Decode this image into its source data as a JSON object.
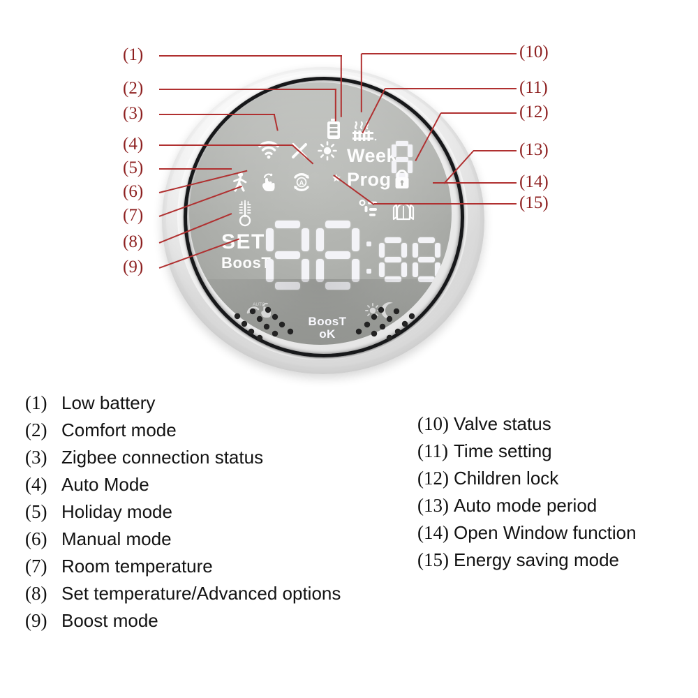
{
  "document": {
    "type": "product-diagram",
    "subject": "Smart radiator thermostat LCD display legend",
    "background_color": "#ffffff",
    "callout_color": "#b03030"
  },
  "device": {
    "name": "round-smart-thermostat",
    "body_color": "#e9e9e9",
    "ring_color": "#17181a",
    "screen_color": "#b0b2ae",
    "segment_color": "#f3f3f7",
    "screen": {
      "labels": {
        "week": "Week",
        "prog": "Prog",
        "set": "SET",
        "boost": "BoosT"
      },
      "temperature_value": "88",
      "time_value": "88",
      "time_separator": ":",
      "icons": [
        "battery-low-icon",
        "radiator-heat-icon",
        "zigbee-signal-icon",
        "cross-icon",
        "sun-comfort-icon",
        "walking-person-holiday-icon",
        "hand-manual-icon",
        "auto-a-circle-icon",
        "moon-star-eco-icon",
        "thermometer-room-temp-icon",
        "padlock-children-lock-icon",
        "open-window-icon",
        "auto-period-segments-icon"
      ]
    },
    "buttons": {
      "left_icon": "auto-manual-toggle-icon",
      "right_icon": "sun-moon-toggle-icon",
      "center_primary": "BoosT",
      "center_secondary": "oK"
    }
  },
  "callouts": {
    "left": [
      {
        "num": "(1)"
      },
      {
        "num": "(2)"
      },
      {
        "num": "(3)"
      },
      {
        "num": "(4)"
      },
      {
        "num": "(5)"
      },
      {
        "num": "(6)"
      },
      {
        "num": "(7)"
      },
      {
        "num": "(8)"
      },
      {
        "num": "(9)"
      }
    ],
    "right": [
      {
        "num": "(10)"
      },
      {
        "num": "(11)"
      },
      {
        "num": "(12)"
      },
      {
        "num": "(13)"
      },
      {
        "num": "(14)"
      },
      {
        "num": "(15)"
      }
    ]
  },
  "legend": {
    "left_column": [
      {
        "num": "(1)",
        "text": "Low battery"
      },
      {
        "num": "(2)",
        "text": "Comfort mode"
      },
      {
        "num": "(3)",
        "text": "Zigbee connection status"
      },
      {
        "num": "(4)",
        "text": "Auto Mode"
      },
      {
        "num": "(5)",
        "text": "Holiday mode"
      },
      {
        "num": "(6)",
        "text": "Manual mode"
      },
      {
        "num": "(7)",
        "text": "Room temperature"
      },
      {
        "num": "(8)",
        "text": "Set temperature/Advanced options"
      },
      {
        "num": "(9)",
        "text": "Boost mode"
      }
    ],
    "right_column": [
      {
        "num": "(10)",
        "text": "Valve status"
      },
      {
        "num": "(11)",
        "text": "Time setting"
      },
      {
        "num": "(12)",
        "text": "Children lock"
      },
      {
        "num": "(13)",
        "text": "Auto mode period"
      },
      {
        "num": "(14)",
        "text": "Open Window function"
      },
      {
        "num": "(15)",
        "text": "Energy saving mode"
      }
    ]
  }
}
